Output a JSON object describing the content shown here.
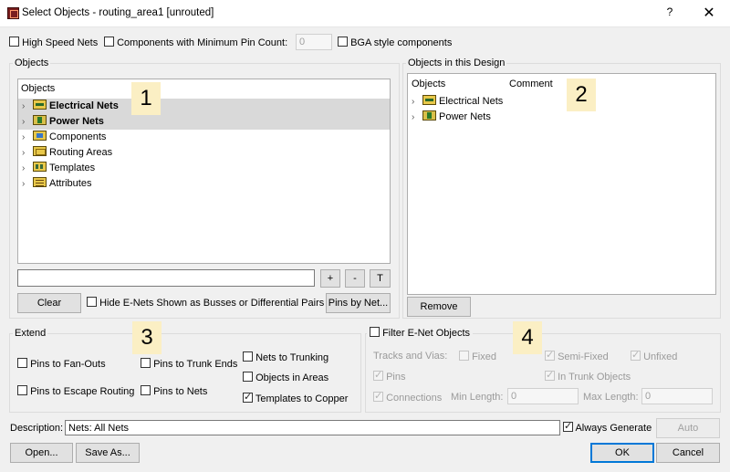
{
  "window": {
    "title": "Select Objects - routing_area1 [unrouted]",
    "help_label": "?",
    "close_label": "✕"
  },
  "top_options": {
    "high_speed_nets": {
      "label": "High Speed Nets",
      "checked": false
    },
    "components_min_pin": {
      "label": "Components with Minimum Pin Count:",
      "checked": false,
      "value": "0"
    },
    "bga_style": {
      "label": "BGA style components",
      "checked": false
    }
  },
  "objects_group": {
    "title": "Objects",
    "header": "Objects",
    "items": [
      {
        "label": "Electrical Nets",
        "icon": "electrical-nets-icon",
        "bold": true,
        "selected": true
      },
      {
        "label": "Power Nets",
        "icon": "power-nets-icon",
        "bold": true,
        "selected": true
      },
      {
        "label": "Components",
        "icon": "components-icon",
        "bold": false,
        "selected": false
      },
      {
        "label": "Routing Areas",
        "icon": "routing-areas-icon",
        "bold": false,
        "selected": false
      },
      {
        "label": "Templates",
        "icon": "templates-icon",
        "bold": false,
        "selected": false
      },
      {
        "label": "Attributes",
        "icon": "attributes-icon",
        "bold": false,
        "selected": false
      }
    ],
    "filter_value": "",
    "plus_label": "+",
    "minus_label": "-",
    "t_label": "T",
    "clear_label": "Clear",
    "hide_enets_label": "Hide E-Nets Shown as Busses or Differential Pairs",
    "pins_by_net_label": "Pins by Net..."
  },
  "design_group": {
    "title": "Objects in this Design",
    "col_objects": "Objects",
    "col_comment": "Comment",
    "items": [
      {
        "label": "Electrical Nets",
        "icon": "electrical-nets-icon"
      },
      {
        "label": "Power Nets",
        "icon": "power-nets-icon"
      }
    ],
    "remove_label": "Remove"
  },
  "extend_group": {
    "title": "Extend",
    "pins_to_fanouts": {
      "label": "Pins to Fan-Outs",
      "checked": false
    },
    "pins_to_escape_routing": {
      "label": "Pins to Escape Routing",
      "checked": false
    },
    "pins_to_trunk_ends": {
      "label": "Pins to Trunk Ends",
      "checked": false
    },
    "pins_to_nets": {
      "label": "Pins to Nets",
      "checked": false
    },
    "nets_to_trunking": {
      "label": "Nets to Trunking",
      "checked": false
    },
    "objects_in_areas": {
      "label": "Objects in Areas",
      "checked": false
    },
    "templates_to_copper": {
      "label": "Templates to Copper",
      "checked": true
    }
  },
  "filter_group": {
    "title": "Filter E-Net Objects",
    "checked": false,
    "tracks_vias_label": "Tracks and Vias:",
    "fixed": {
      "label": "Fixed",
      "checked": false
    },
    "semi_fixed": {
      "label": "Semi-Fixed",
      "checked": true
    },
    "unfixed": {
      "label": "Unfixed",
      "checked": true
    },
    "pins": {
      "label": "Pins",
      "checked": true
    },
    "in_trunk_objects": {
      "label": "In Trunk Objects",
      "checked": true
    },
    "connections": {
      "label": "Connections",
      "checked": true
    },
    "min_length_label": "Min Length:",
    "min_length_value": "0",
    "max_length_label": "Max Length:",
    "max_length_value": "0"
  },
  "description": {
    "label": "Description:",
    "value": "Nets: All Nets",
    "always_generate": {
      "label": "Always Generate",
      "checked": true
    },
    "auto_label": "Auto"
  },
  "footer": {
    "open_label": "Open...",
    "save_as_label": "Save As...",
    "ok_label": "OK",
    "cancel_label": "Cancel"
  },
  "callouts": [
    "1",
    "2",
    "3",
    "4"
  ],
  "colors": {
    "selection": "#d9d9d9",
    "callout_bg": "#fbefc4",
    "default_button_border": "#0078d7"
  }
}
